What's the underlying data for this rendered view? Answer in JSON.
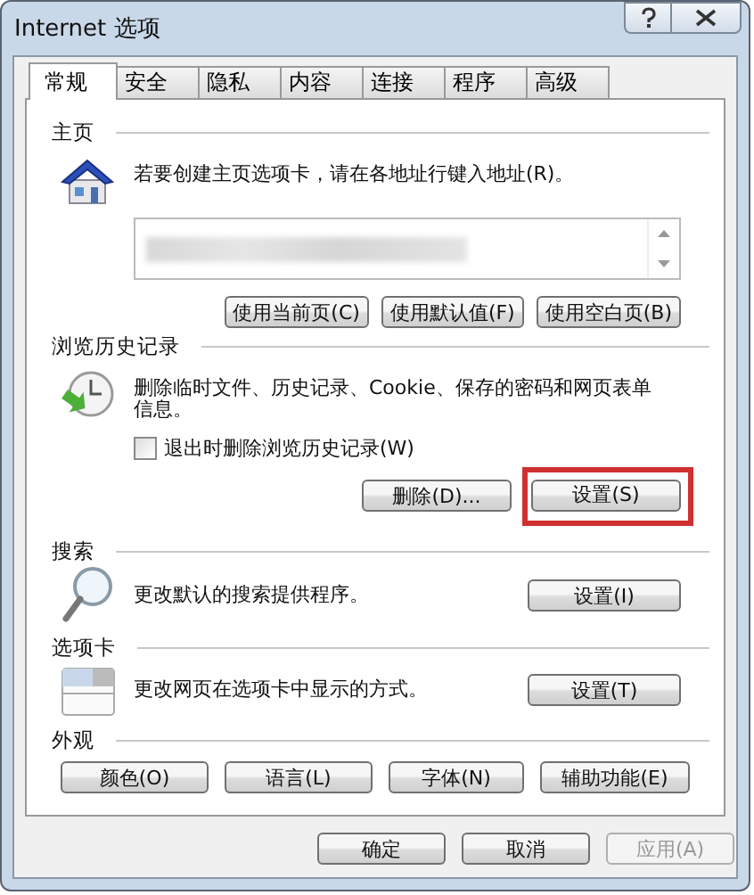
{
  "window": {
    "title": "Internet 选项"
  },
  "tabs": [
    {
      "label": "常规",
      "selected": true
    },
    {
      "label": "安全",
      "selected": false
    },
    {
      "label": "隐私",
      "selected": false
    },
    {
      "label": "内容",
      "selected": false
    },
    {
      "label": "连接",
      "selected": false
    },
    {
      "label": "程序",
      "selected": false
    },
    {
      "label": "高级",
      "selected": false
    }
  ],
  "homepage": {
    "title": "主页",
    "text": "若要创建主页选项卡，请在各地址行键入地址(R)。",
    "buttons": [
      "使用当前页(C)",
      "使用默认值(F)",
      "使用空白页(B)"
    ]
  },
  "history": {
    "title": "浏览历史记录",
    "text": "删除临时文件、历史记录、Cookie、保存的密码和网页表单信息。",
    "checkbox": {
      "label": "退出时删除浏览历史记录(W)",
      "checked": false
    },
    "buttons": [
      {
        "label": "删除(D)...",
        "highlighted": false
      },
      {
        "label": "设置(S)",
        "highlighted": true
      }
    ]
  },
  "search": {
    "title": "搜索",
    "text": "更改默认的搜索提供程序。",
    "button": "设置(I)"
  },
  "tab_settings": {
    "title": "选项卡",
    "text": "更改网页在选项卡中显示的方式。",
    "button": "设置(T)"
  },
  "appearance": {
    "title": "外观",
    "buttons": [
      "颜色(O)",
      "语言(L)",
      "字体(N)",
      "辅助功能(E)"
    ]
  },
  "footer": [
    {
      "label": "确定",
      "disabled": false
    },
    {
      "label": "取消",
      "disabled": false
    },
    {
      "label": "应用(A)",
      "disabled": true
    }
  ]
}
